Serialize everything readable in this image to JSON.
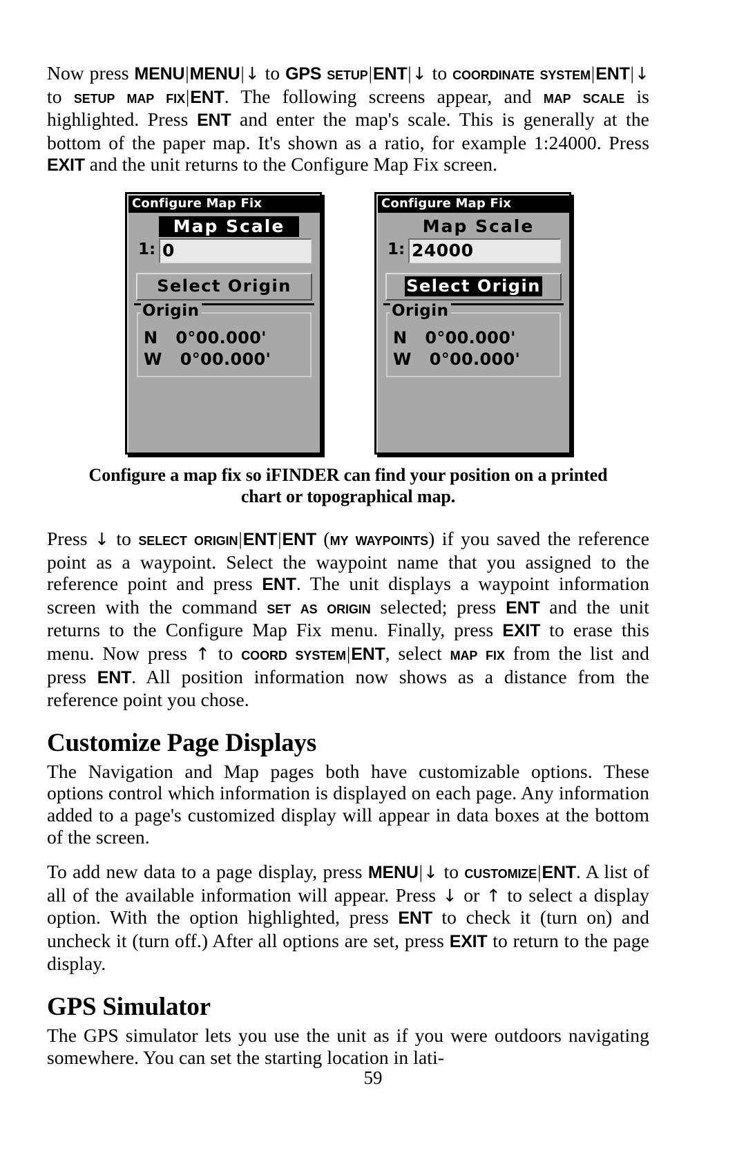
{
  "page": {
    "number": "59"
  },
  "paragraphs": {
    "p1": {
      "s1": "Now press ",
      "k_menu1": "MENU",
      "bar1": "|",
      "k_menu2": "MENU",
      "bar2": "|",
      "arrow1": "↓",
      "s2": " to ",
      "k_gps": "GPS",
      "sp1": " ",
      "k_setup": "Setup",
      "bar3": "|",
      "k_ent1": "ENT",
      "bar4": "|",
      "arrow2": "↓",
      "s3": " to ",
      "k_coordsys": "Coordinate System",
      "bar5": "|",
      "k_ent2": "ENT",
      "bar6": "|",
      "arrow3": "↓",
      "s4": " to ",
      "k_setupmapfix": "Setup Map Fix",
      "bar7": "|",
      "k_ent3": "ENT",
      "s5": ". The following screens appear, and ",
      "k_mapscale": "Map Scale",
      "s6": " is highlighted. Press ",
      "k_ent4": "ENT",
      "s7": " and enter the map's scale. This is generally at the bottom of the paper map. It's shown as a ratio, for example 1:24000. Press ",
      "k_exit": "EXIT",
      "s8": " and the unit returns to the Configure Map Fix screen."
    },
    "p2": {
      "s1": "Press ",
      "arrow1": "↓",
      "s2": " to ",
      "k_selectorigin": "Select Origin",
      "bar1": "|",
      "k_ent1": "ENT",
      "bar2": "|",
      "k_ent2": "ENT",
      "s3": " (",
      "k_mywaypoints": "My Waypoints",
      "s4": ") if you saved the reference point as a waypoint. Select the waypoint name that you assigned to the reference point and press ",
      "k_ent3": "ENT",
      "s5": ". The unit displays a waypoint information screen with the command ",
      "k_setasorigin": "Set As Origin",
      "s6": " selected; press ",
      "k_ent4": "ENT",
      "s7": " and the unit returns to the Configure Map Fix menu. Finally, press ",
      "k_exit": "EXIT",
      "s8": " to erase this menu. Now press ",
      "arrow2": "↑",
      "s9": " to ",
      "k_coordsystem": "Coord System",
      "bar3": "|",
      "k_ent5": "ENT",
      "s10": ", select ",
      "k_mapfix": "Map Fix",
      "s11": " from the list and press ",
      "k_ent6": "ENT",
      "s12": ". All position information now shows as a distance from the reference point you chose."
    },
    "p3": {
      "text": "The Navigation and Map pages both have customizable options. These options control which information is displayed on each page. Any information added to a page's customized display will appear in data boxes at the bottom of the screen."
    },
    "p4": {
      "s1": "To add new data to a page display, press ",
      "k_menu": "MENU",
      "bar1": "|",
      "arrow1": "↓",
      "s2": " to ",
      "k_customize": "Customize",
      "bar2": "|",
      "k_ent1": "ENT",
      "s3": ". A list of all of the available information will appear. Press ",
      "arrow2": "↓",
      "s4": " or ",
      "arrow3": "↑",
      "s5": " to select a display option. With the option highlighted, press ",
      "k_ent2": "ENT",
      "s6": " to check it (turn on) and uncheck it (turn off.) After all options are set, press ",
      "k_exit": "EXIT",
      "s7": " to return to the page display."
    },
    "p5": {
      "text": "The GPS simulator lets you use the unit as if you were outdoors navigating somewhere. You can set the starting location in lati-"
    }
  },
  "headings": {
    "customize": "Customize Page Displays",
    "simulator": "GPS Simulator"
  },
  "figure": {
    "caption_line1": "Configure a map fix so iFINDER can find your position on a printed",
    "caption_line2": "chart or topographical map.",
    "screen_left": {
      "title": "Configure Map Fix",
      "scale_label": "Map Scale",
      "scale_label_highlighted": true,
      "scale_prefix": "1:",
      "scale_value": "0",
      "button_label": "Select Origin",
      "button_highlighted": false,
      "origin_legend": "Origin",
      "lat_hemisphere": "N",
      "lat_value": "0°00.000'",
      "lon_hemisphere": "W",
      "lon_value": "0°00.000'"
    },
    "screen_right": {
      "title": "Configure Map Fix",
      "scale_label": "Map Scale",
      "scale_label_highlighted": false,
      "scale_prefix": "1:",
      "scale_value": "24000",
      "button_label": "Select Origin",
      "button_highlighted": true,
      "origin_legend": "Origin",
      "lat_hemisphere": "N",
      "lat_value": "0°00.000'",
      "lon_hemisphere": "W",
      "lon_value": "0°00.000'"
    }
  }
}
